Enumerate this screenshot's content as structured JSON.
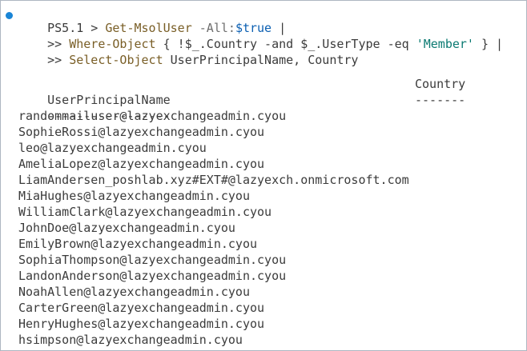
{
  "terminal": {
    "prompt_lines": [
      {
        "prefix": "PS5.1 > ",
        "cmd": "Get-MsolUser",
        "param": " -All:",
        "var": "$true",
        "tail": " |"
      },
      {
        "prefix": ">> ",
        "cmd": "Where-Object",
        "p1": " { !",
        "v1": "$_",
        "p2": ".Country -and ",
        "v2": "$_",
        "p3": ".UserType -eq ",
        "str": "'Member'",
        "tail": " } |"
      },
      {
        "prefix": ">> ",
        "cmd": "Select-Object",
        "args": " UserPrincipalName, Country"
      }
    ],
    "output": {
      "col1_header": "UserPrincipalName",
      "col2_header": "Country",
      "col1_rule": "-----------------",
      "col2_rule": "-------",
      "rows": [
        "randommailuser@lazyexchangeadmin.cyou",
        "SophieRossi@lazyexchangeadmin.cyou",
        "leo@lazyexchangeadmin.cyou",
        "AmeliaLopez@lazyexchangeadmin.cyou",
        "LiamAndersen_poshlab.xyz#EXT#@lazyexch.onmicrosoft.com",
        "MiaHughes@lazyexchangeadmin.cyou",
        "WilliamClark@lazyexchangeadmin.cyou",
        "JohnDoe@lazyexchangeadmin.cyou",
        "EmilyBrown@lazyexchangeadmin.cyou",
        "SophiaThompson@lazyexchangeadmin.cyou",
        "LandonAnderson@lazyexchangeadmin.cyou",
        "NoahAllen@lazyexchangeadmin.cyou",
        "CarterGreen@lazyexchangeadmin.cyou",
        "HenryHughes@lazyexchangeadmin.cyou",
        "hsimpson@lazyexchangeadmin.cyou"
      ]
    }
  },
  "colors": {
    "background": "#ffffff",
    "text": "#3b3b3b",
    "cmdlet": "#795e26",
    "parameter": "#6e6e6e",
    "variable": "#0b5fb2",
    "string": "#0b7a72",
    "status_dot": "#1a85d6"
  }
}
